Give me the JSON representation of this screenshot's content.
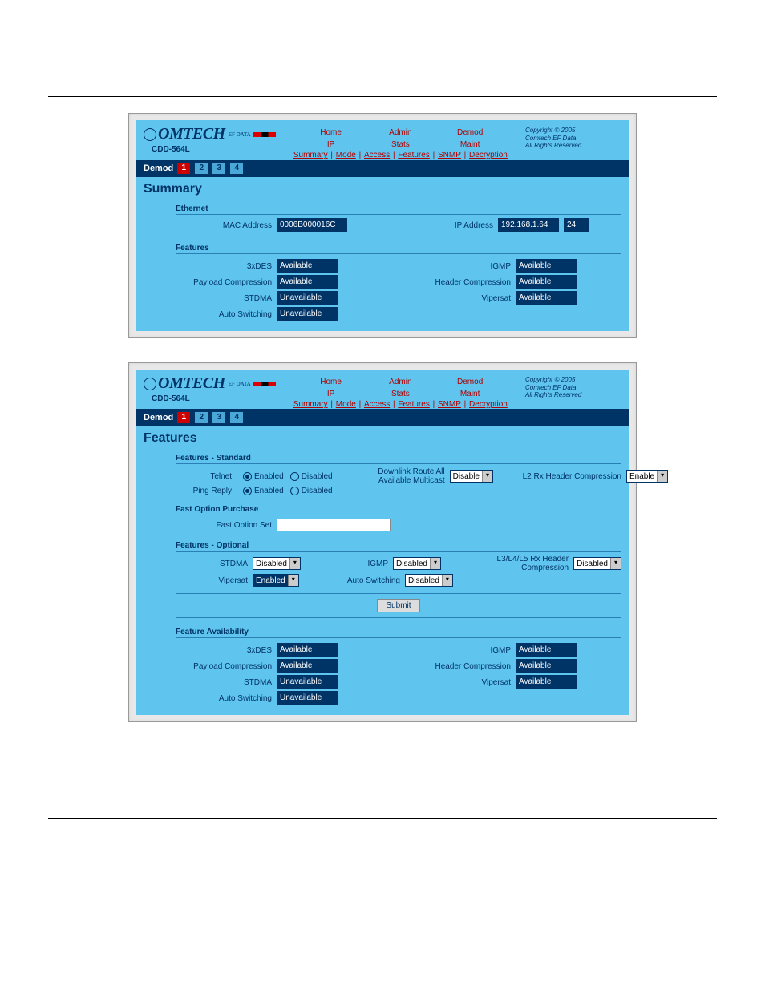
{
  "model": "CDD-564L",
  "nav": {
    "tabs": [
      "Home",
      "Admin",
      "Demod",
      "IP",
      "Stats",
      "Maint"
    ],
    "subnav": [
      "Summary",
      "Mode",
      "Access",
      "Features",
      "SNMP",
      "Decryption"
    ]
  },
  "copyright": {
    "line1": "Copyright © 2005",
    "line2": "Comtech EF Data",
    "line3": "All Rights Reserved"
  },
  "demod": {
    "label": "Demod",
    "tabs": [
      "1",
      "2",
      "3",
      "4"
    ],
    "selected": 0
  },
  "screen1": {
    "title": "Summary",
    "ethernet": {
      "header": "Ethernet",
      "mac_label": "MAC Address",
      "mac_value": "0006B000016C",
      "ip_label": "IP Address",
      "ip_value": "192.168.1.64",
      "mask": "24"
    },
    "features": {
      "header": "Features",
      "items_left": [
        {
          "label": "3xDES",
          "value": "Available"
        },
        {
          "label": "Payload Compression",
          "value": "Available"
        },
        {
          "label": "STDMA",
          "value": "Unavailable"
        },
        {
          "label": "Auto Switching",
          "value": "Unavailable"
        }
      ],
      "items_right": [
        {
          "label": "IGMP",
          "value": "Available"
        },
        {
          "label": "Header Compression",
          "value": "Available"
        },
        {
          "label": "Vipersat",
          "value": "Available"
        }
      ]
    }
  },
  "screen2": {
    "title": "Features",
    "standard": {
      "header": "Features - Standard",
      "telnet_label": "Telnet",
      "ping_label": "Ping Reply",
      "enabled": "Enabled",
      "disabled": "Disabled",
      "downlink_label": "Downlink Route All Available Multicast",
      "downlink_value": "Disable",
      "l2_label": "L2 Rx Header Compression",
      "l2_value": "Enable"
    },
    "fast": {
      "header": "Fast Option Purchase",
      "label": "Fast Option Set"
    },
    "optional": {
      "header": "Features - Optional",
      "stdma_label": "STDMA",
      "stdma_value": "Disabled",
      "igmp_label": "IGMP",
      "igmp_value": "Disabled",
      "l345_label": "L3/L4/L5 Rx Header Compression",
      "l345_value": "Disabled",
      "vipersat_label": "Vipersat",
      "vipersat_value": "Enabled",
      "autoswitch_label": "Auto Switching",
      "autoswitch_value": "Disabled"
    },
    "submit": "Submit",
    "availability": {
      "header": "Feature Availability",
      "items_left": [
        {
          "label": "3xDES",
          "value": "Available"
        },
        {
          "label": "Payload Compression",
          "value": "Available"
        },
        {
          "label": "STDMA",
          "value": "Unavailable"
        },
        {
          "label": "Auto Switching",
          "value": "Unavailable"
        }
      ],
      "items_right": [
        {
          "label": "IGMP",
          "value": "Available"
        },
        {
          "label": "Header Compression",
          "value": "Available"
        },
        {
          "label": "Vipersat",
          "value": "Available"
        }
      ]
    }
  }
}
